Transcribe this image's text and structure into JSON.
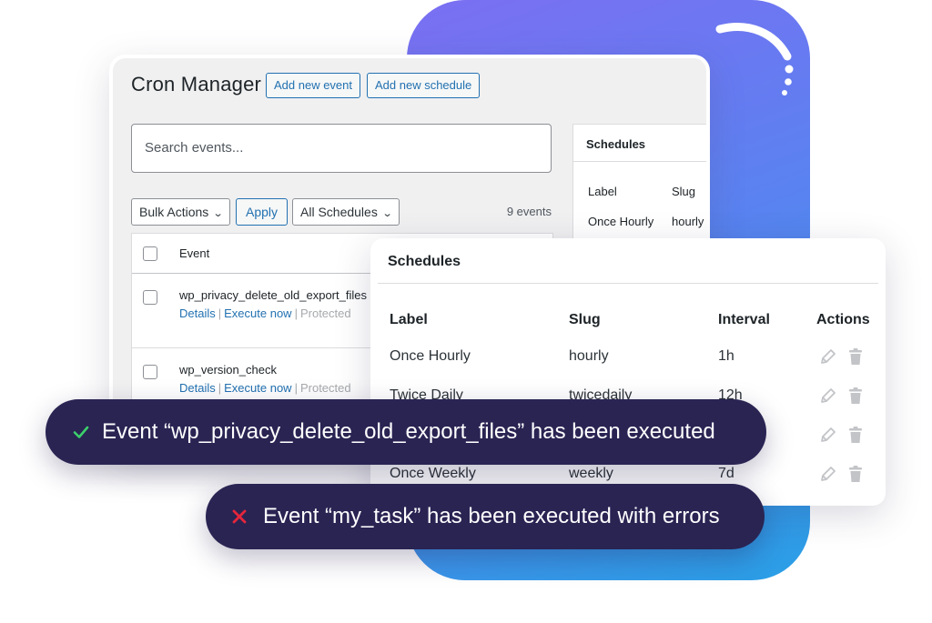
{
  "header": {
    "title": "Cron Manager",
    "add_event_label": "Add new event",
    "add_schedule_label": "Add new schedule"
  },
  "search": {
    "placeholder": "Search events..."
  },
  "toolbar": {
    "bulk_actions": "Bulk Actions",
    "apply_label": "Apply",
    "schedule_filter": "All Schedules",
    "events_count": "9 events"
  },
  "events_table": {
    "column_event": "Event",
    "rows": [
      {
        "name": "wp_privacy_delete_old_export_files",
        "details": "Details",
        "execute": "Execute now",
        "status": "Protected"
      },
      {
        "name": "wp_version_check",
        "details": "Details",
        "execute": "Execute now",
        "status": "Protected"
      }
    ]
  },
  "side_schedules": {
    "title": "Schedules",
    "col_label": "Label",
    "col_slug": "Slug",
    "row": {
      "label": "Once Hourly",
      "slug": "hourly"
    }
  },
  "schedules_card": {
    "title": "Schedules",
    "columns": {
      "label": "Label",
      "slug": "Slug",
      "interval": "Interval",
      "actions": "Actions"
    },
    "rows": [
      {
        "label": "Once Hourly",
        "slug": "hourly",
        "interval": "1h"
      },
      {
        "label": "Twice Daily",
        "slug": "twicedaily",
        "interval": "12h"
      },
      {
        "label": "",
        "slug": "",
        "interval": ""
      },
      {
        "label": "Once Weekly",
        "slug": "weekly",
        "interval": "7d"
      }
    ]
  },
  "notifications": {
    "success": "Event “wp_privacy_delete_old_export_files” has been executed",
    "error": "Event “my_task” has been executed with errors"
  },
  "colors": {
    "accent": "#2271b1",
    "toast_bg": "#2a2453",
    "success": "#3ccf6b",
    "error": "#e5263b"
  },
  "icons": {
    "success": "check-icon",
    "error": "cross-icon",
    "edit": "pencil-icon",
    "delete": "trash-icon",
    "dropdown": "chevron-down-icon"
  }
}
